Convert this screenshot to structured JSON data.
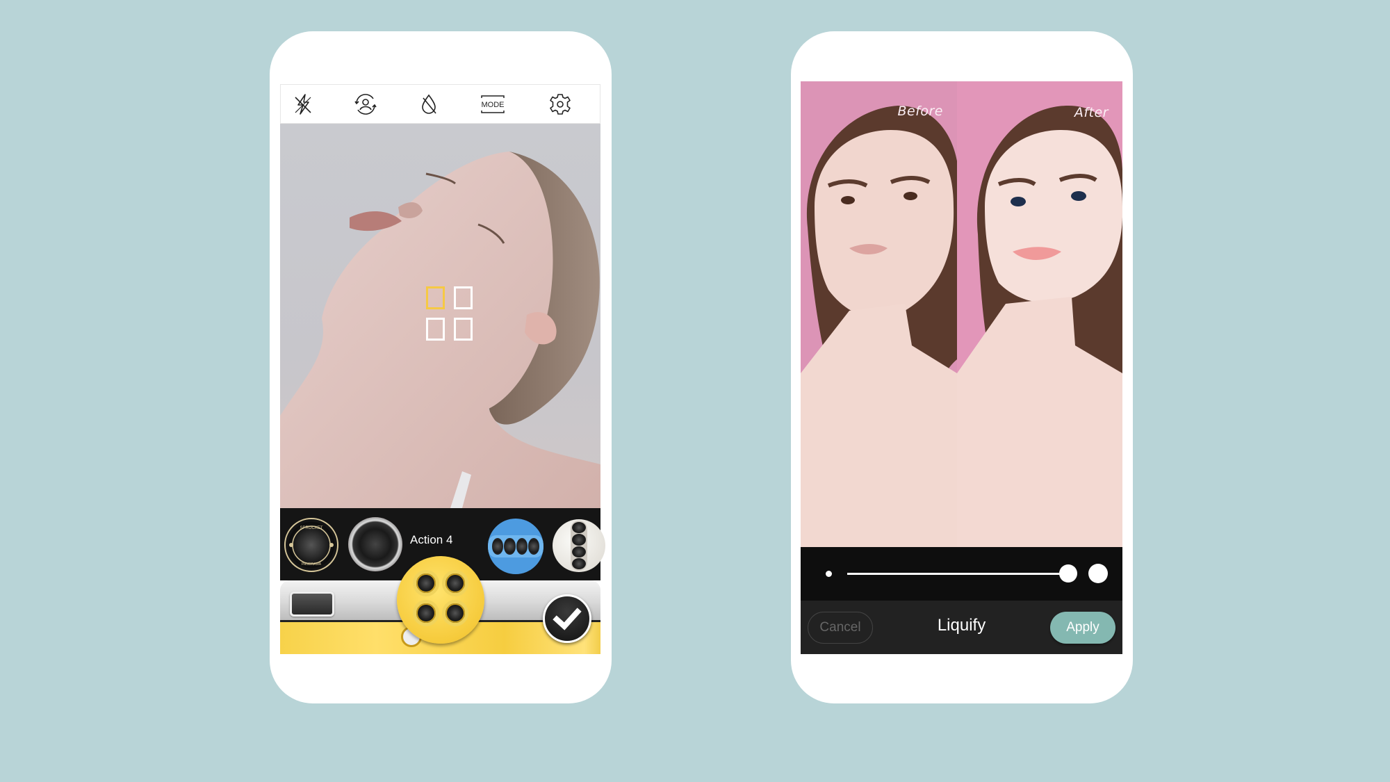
{
  "left_phone": {
    "toolbar": [
      {
        "icon": "flash-off-icon",
        "label": "Flash off"
      },
      {
        "icon": "switch-camera-icon",
        "label": "Switch camera"
      },
      {
        "icon": "color-off-icon",
        "label": "Color effect off"
      },
      {
        "icon": "mode-icon",
        "label": "MODE"
      },
      {
        "icon": "gear-icon",
        "label": "Settings"
      }
    ],
    "focus_grid": {
      "active_index": 0,
      "count": 4
    },
    "lens_strip": {
      "selected_label": "Action 4",
      "lenses": [
        {
          "name": "Sprocket Panorama",
          "text_top": "SPROCKET",
          "text_bottom": "PANORAMA"
        },
        {
          "name": "Pink ring lens"
        },
        {
          "name": "Action 4",
          "selected": true
        },
        {
          "name": "Blue 4-lens strip"
        },
        {
          "name": "White vertical 4-lens"
        }
      ]
    },
    "colors": {
      "accent_yellow": "#f6c944",
      "strip_bg": "#151515"
    }
  },
  "right_phone": {
    "compare": {
      "before_label": "Before",
      "after_label": "After"
    },
    "slider": {
      "value_percent": 100
    },
    "action_bar": {
      "cancel_label": "Cancel",
      "title": "Liquify",
      "apply_label": "Apply"
    },
    "colors": {
      "apply_bg": "#84b8b1",
      "pink_bg": "#dc94b6"
    }
  }
}
